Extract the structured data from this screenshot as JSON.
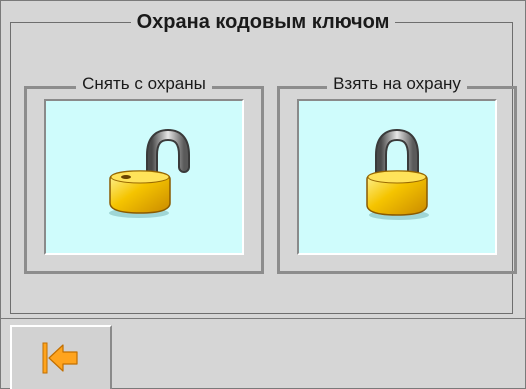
{
  "panel": {
    "title": "Охрана кодовым ключом"
  },
  "disarm": {
    "label": "Снять с охраны",
    "icon": "unlocked-padlock-icon"
  },
  "arm": {
    "label": "Взять на охрану",
    "icon": "locked-padlock-icon"
  },
  "navigation": {
    "back_icon": "back-arrow-icon"
  },
  "colors": {
    "background": "#d6d6d6",
    "button_face": "#cffcfc",
    "lock_gold": "#f2b700",
    "arrow_orange": "#ffa41e"
  }
}
